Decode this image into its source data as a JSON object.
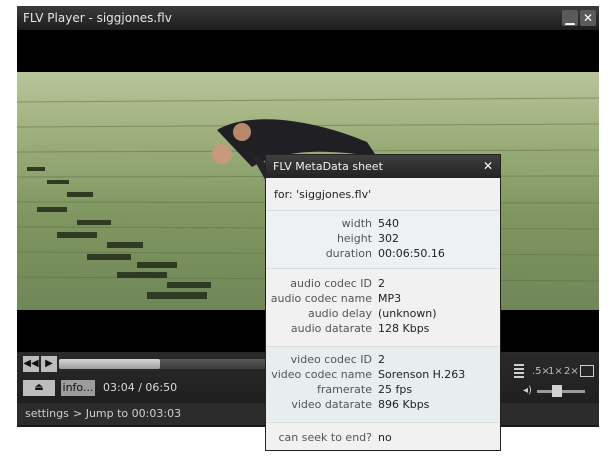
{
  "window": {
    "title": "FLV Player - siggjones.flv",
    "minimize": "▁",
    "close": "✕"
  },
  "controls": {
    "prev": "◀◀",
    "play": "▶",
    "eject": "⏏",
    "info_label": "info...",
    "time": "03:04 / 06:50",
    "seek_fraction": 0.45,
    "zoom": {
      "half": ".5×",
      "one": "1×",
      "two": "2×"
    },
    "volume_fraction": 0.42,
    "settings_label": "settings",
    "jump_label": "> Jump to 00:03:03"
  },
  "metadata_sheet": {
    "title": "FLV MetaData sheet",
    "close": "✕",
    "for_label": "for: 'siggjones.flv'",
    "video_props": [
      {
        "key": "width",
        "value": "540"
      },
      {
        "key": "height",
        "value": "302"
      },
      {
        "key": "duration",
        "value": "00:06:50.16"
      }
    ],
    "audio_props": [
      {
        "key": "audio codec ID",
        "value": "2"
      },
      {
        "key": "audio codec name",
        "value": "MP3"
      },
      {
        "key": "audio delay",
        "value": "(unknown)"
      },
      {
        "key": "audio datarate",
        "value": "128 Kbps"
      }
    ],
    "codec_props": [
      {
        "key": "video codec ID",
        "value": "2"
      },
      {
        "key": "video codec name",
        "value": "Sorenson H.263"
      },
      {
        "key": "framerate",
        "value": "25 fps"
      },
      {
        "key": "video datarate",
        "value": "896 Kbps"
      }
    ],
    "seek_props": [
      {
        "key": "can seek to end?",
        "value": "no"
      }
    ]
  },
  "colors": {
    "accent": "#1e1e1e",
    "sheet_bg": "#f1f1f1",
    "section_bg": "#e8edf0"
  }
}
